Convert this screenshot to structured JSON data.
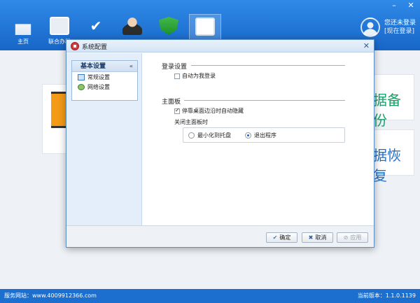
{
  "app": {
    "nav": [
      {
        "label": "主页",
        "icon": "home-icon"
      },
      {
        "label": "联合办税",
        "icon": "monitor-icon"
      },
      {
        "label": "",
        "icon": "check-icon"
      },
      {
        "label": "",
        "icon": "support-agent-icon"
      },
      {
        "label": "",
        "icon": "shield-icon"
      },
      {
        "label": "",
        "icon": "id-card-icon"
      }
    ],
    "user": {
      "status": "您还未登录",
      "login": "[现在登录]"
    },
    "window_controls": {
      "minimize": "–",
      "close": "✕"
    }
  },
  "background": {
    "card_backup": "据备份",
    "card_restore": "据恢复"
  },
  "statusbar": {
    "left": "服务网站：www.4009912366.com",
    "right": "当前版本：1.1.0.1139"
  },
  "dialog": {
    "title": "系统配置",
    "close": "✕",
    "sidebar": {
      "group_title": "基本设置",
      "collapse": "«",
      "items": [
        "常规设置",
        "网络设置"
      ]
    },
    "login_section": {
      "title": "登录设置",
      "auto_login": {
        "label": "自动为我登录",
        "checked": false
      }
    },
    "panel_section": {
      "title": "主面板",
      "auto_hide": {
        "label": "停靠桌面边沿时自动隐藏",
        "checked": true
      },
      "close_label": "关闭主面板时",
      "options": [
        {
          "label": "最小化到托盘",
          "selected": false
        },
        {
          "label": "退出程序",
          "selected": true
        }
      ]
    },
    "buttons": {
      "ok": "确定",
      "cancel": "取消",
      "apply": "应用"
    }
  }
}
